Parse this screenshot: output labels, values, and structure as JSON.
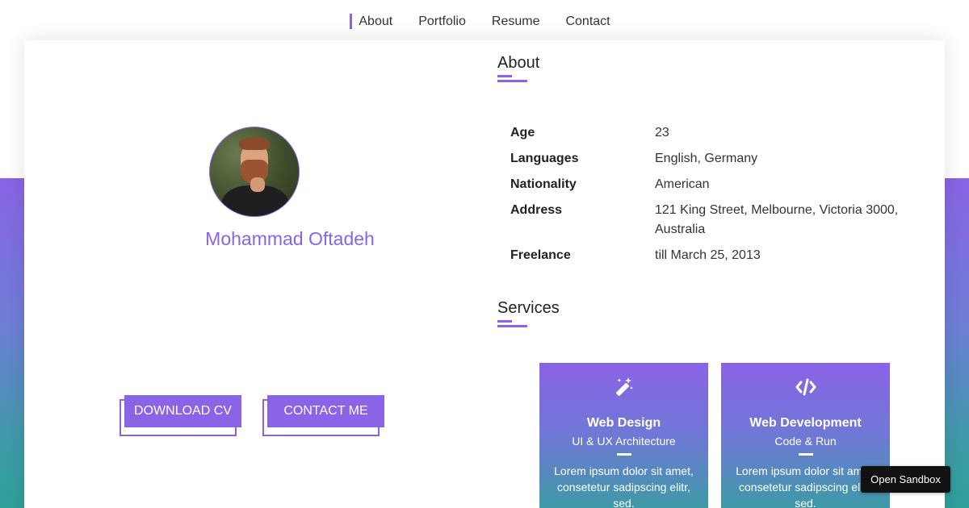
{
  "nav": {
    "items": [
      {
        "label": "About",
        "active": true
      },
      {
        "label": "Portfolio",
        "active": false
      },
      {
        "label": "Resume",
        "active": false
      },
      {
        "label": "Contact",
        "active": false
      }
    ]
  },
  "profile": {
    "name": "Mohammad Oftadeh",
    "download_label": "DOWNLOAD CV",
    "contact_label": "CONTACT ME"
  },
  "about": {
    "title": "About",
    "rows": [
      {
        "label": "Age",
        "value": "23"
      },
      {
        "label": "Languages",
        "value": "English, Germany"
      },
      {
        "label": "Nationality",
        "value": "American"
      },
      {
        "label": "Address",
        "value": "121 King Street, Melbourne, Victoria 3000,",
        "value2": "Australia"
      },
      {
        "label": "Freelance",
        "value": "till March 25, 2013"
      }
    ]
  },
  "services": {
    "title": "Services",
    "items": [
      {
        "title": "Web Design",
        "subtitle": "UI & UX Architecture",
        "desc1": "Lorem ipsum dolor sit amet,",
        "desc2": "consetetur sadipscing elitr, sed.",
        "icon": "magic-wand-icon"
      },
      {
        "title": "Web Development",
        "subtitle": "Code & Run",
        "desc1": "Lorem ipsum dolor sit amet,",
        "desc2": "consetetur sadipscing elitr, sed.",
        "icon": "code-icon"
      }
    ]
  },
  "sandbox": {
    "label": "Open Sandbox"
  },
  "colors": {
    "accent": "#8a63e6",
    "gradient_end": "#2fa099"
  }
}
